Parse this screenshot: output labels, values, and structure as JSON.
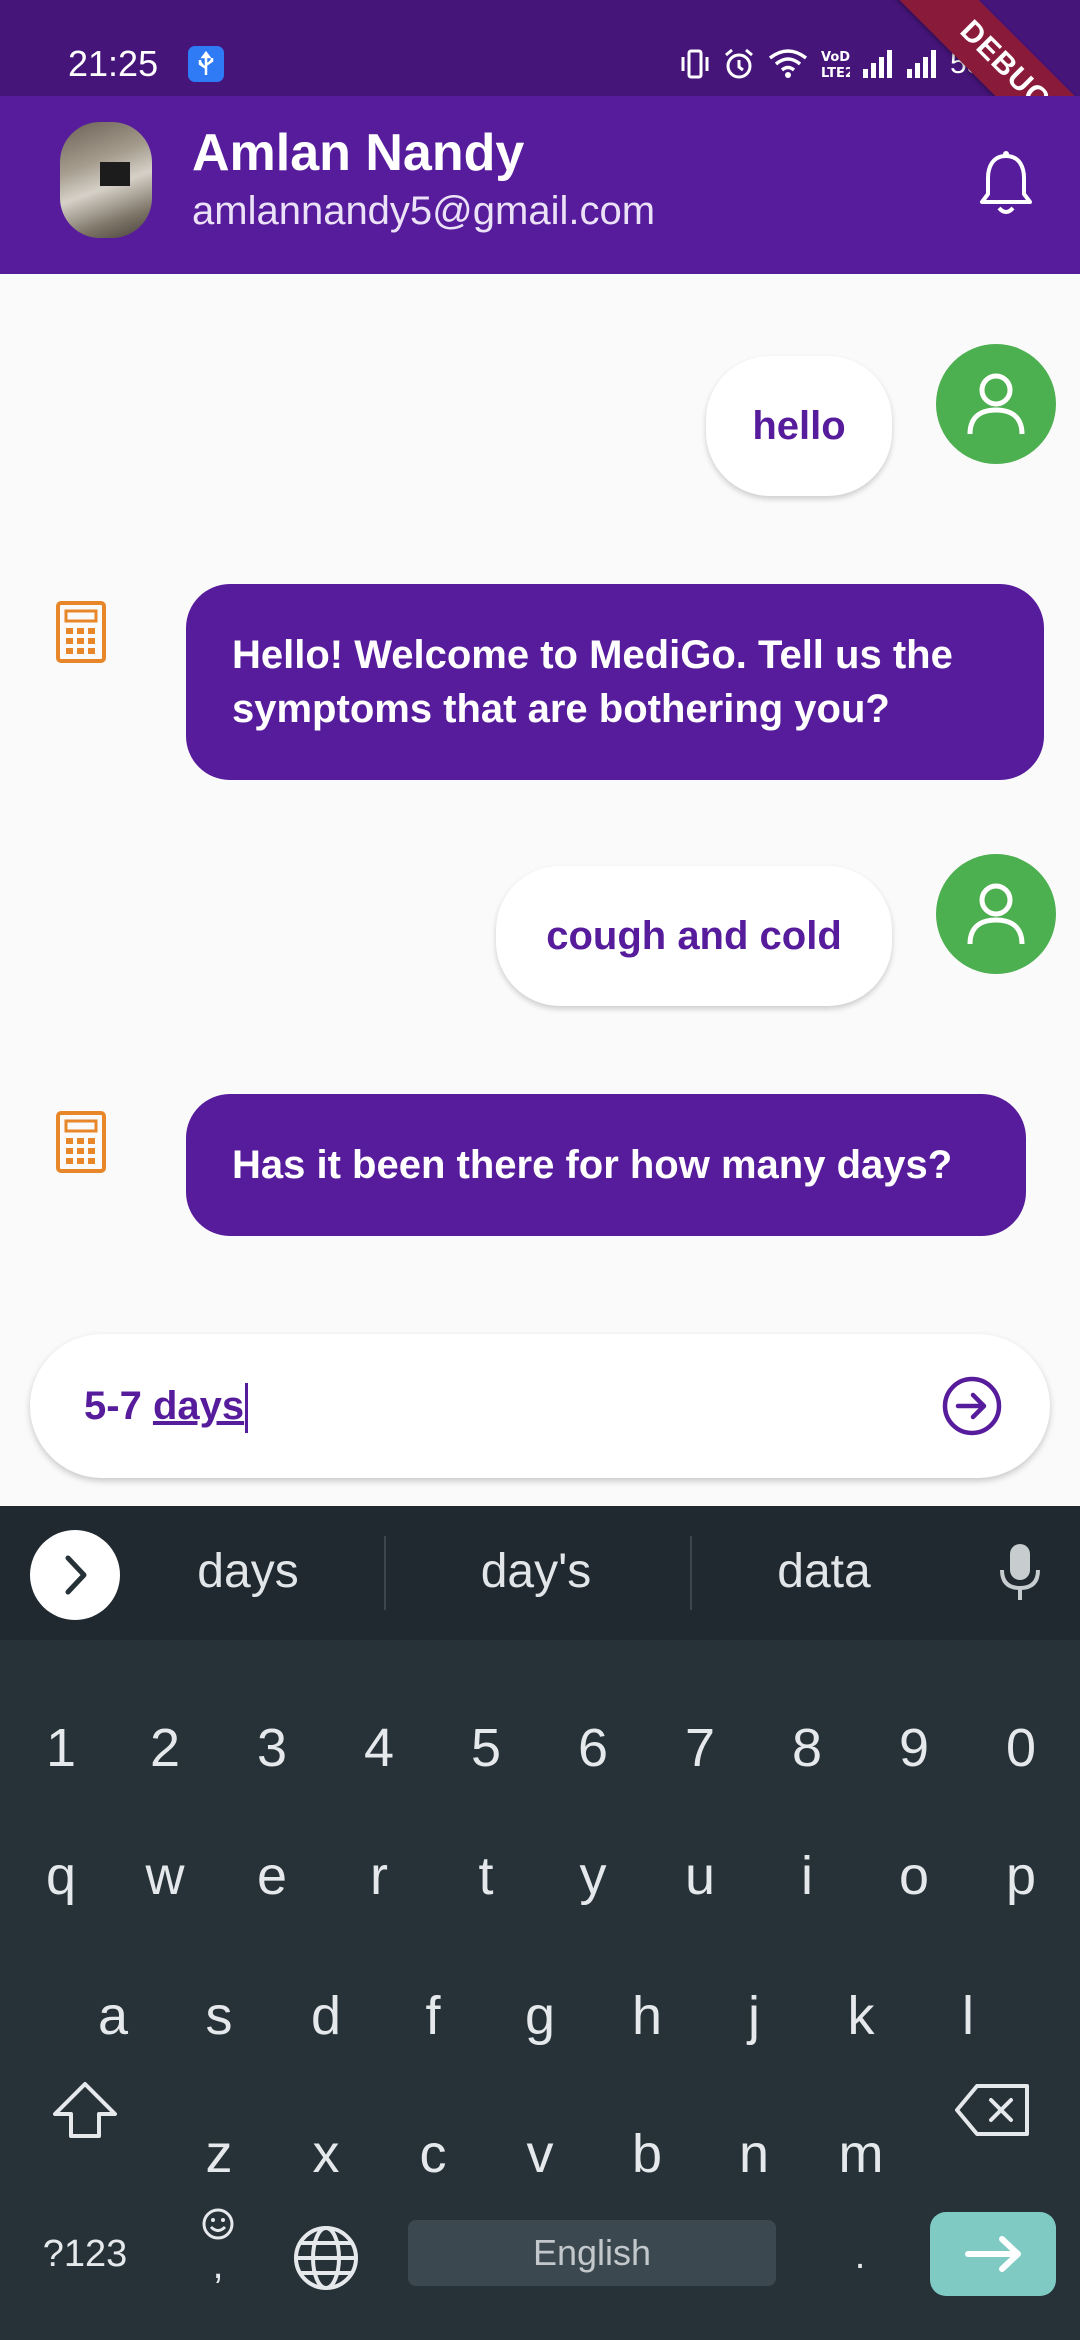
{
  "status_bar": {
    "time": "21:25",
    "battery": "55%",
    "icons": [
      "usb-icon",
      "vibrate-icon",
      "alarm-icon",
      "wifi-icon",
      "volte-icon",
      "signal-icon",
      "signal-icon",
      "battery-icon"
    ]
  },
  "debug_banner": "DEBUG",
  "header": {
    "name": "Amlan Nandy",
    "email": "amlannandy5@gmail.com",
    "bell_icon": "bell-icon"
  },
  "messages": [
    {
      "sender": "user",
      "text": "hello"
    },
    {
      "sender": "bot",
      "text": "Hello! Welcome to MediGo. Tell us the symptoms that are bothering you?"
    },
    {
      "sender": "user",
      "text": "cough and cold"
    },
    {
      "sender": "bot",
      "text": "Has it been there for how many days?"
    }
  ],
  "input": {
    "prefix": "5-7",
    "underlined": "days",
    "send_icon": "arrow-right-circle-icon"
  },
  "keyboard": {
    "suggestions": [
      "days",
      "day's",
      "data"
    ],
    "row_numbers": [
      "1",
      "2",
      "3",
      "4",
      "5",
      "6",
      "7",
      "8",
      "9",
      "0"
    ],
    "row_1": [
      "q",
      "w",
      "e",
      "r",
      "t",
      "y",
      "u",
      "i",
      "o",
      "p"
    ],
    "row_2": [
      "a",
      "s",
      "d",
      "f",
      "g",
      "h",
      "j",
      "k",
      "l"
    ],
    "row_3": [
      "z",
      "x",
      "c",
      "v",
      "b",
      "n",
      "m"
    ],
    "symbols_label": "?123",
    "emoji_comma": ",",
    "space_label": "English",
    "period": "."
  },
  "colors": {
    "status_bar": "#451579",
    "app_bar": "#571c9c",
    "bot_bubble": "#571c9c",
    "user_avatar": "#4caf50",
    "bot_icon": "#e8872a",
    "keyboard_bg": "#263238",
    "enter_key": "#7fcbc4"
  }
}
